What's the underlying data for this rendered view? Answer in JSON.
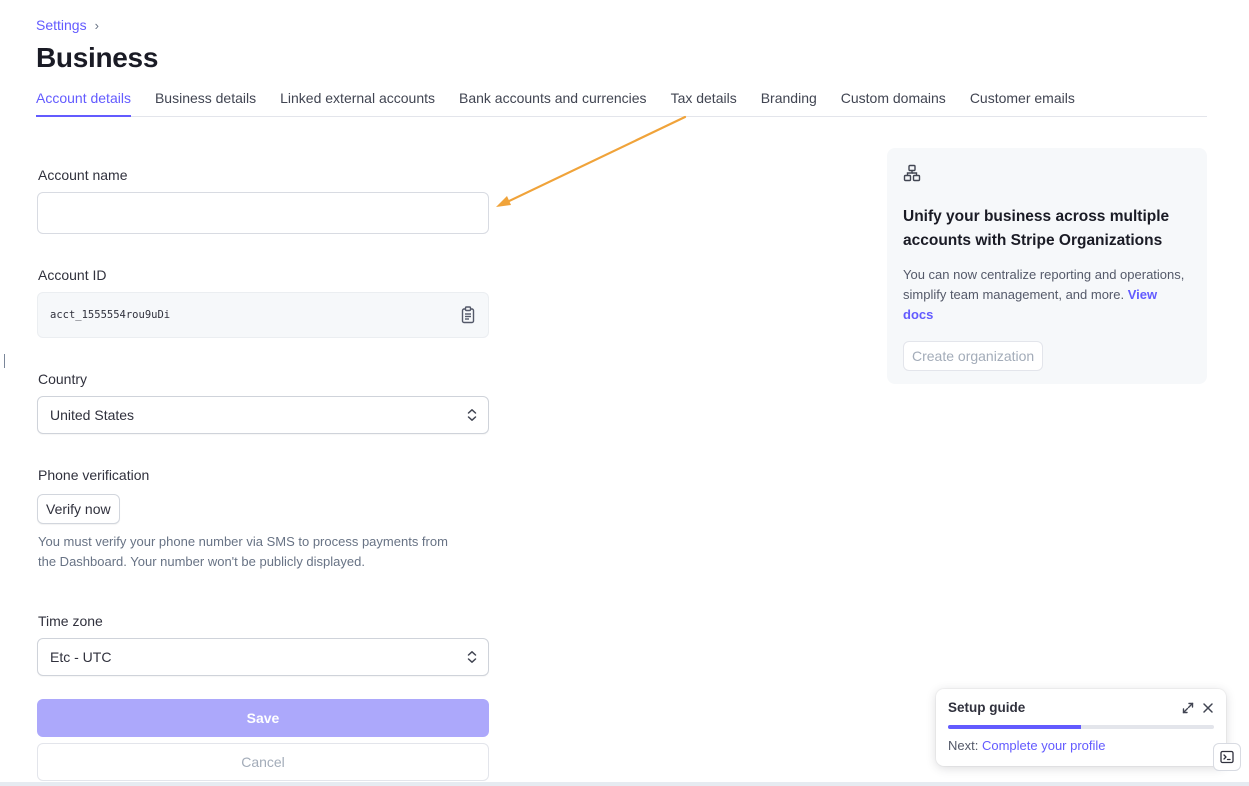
{
  "breadcrumb": {
    "parent": "Settings",
    "separator": "›"
  },
  "page": {
    "title": "Business"
  },
  "tabs": [
    {
      "label": "Account details",
      "active": true
    },
    {
      "label": "Business details",
      "active": false
    },
    {
      "label": "Linked external accounts",
      "active": false
    },
    {
      "label": "Bank accounts and currencies",
      "active": false
    },
    {
      "label": "Tax details",
      "active": false
    },
    {
      "label": "Branding",
      "active": false
    },
    {
      "label": "Custom domains",
      "active": false
    },
    {
      "label": "Customer emails",
      "active": false
    }
  ],
  "form": {
    "account_name": {
      "label": "Account name",
      "value": "",
      "placeholder": ""
    },
    "account_id": {
      "label": "Account ID",
      "value": "acct_1555554rou9uDi",
      "icon": "clipboard-icon"
    },
    "country": {
      "label": "Country",
      "value": "United States"
    },
    "phone": {
      "label": "Phone verification",
      "button": "Verify now",
      "help": "You must verify your phone number via SMS to process payments from the Dashboard. Your number won't be publicly displayed."
    },
    "timezone": {
      "label": "Time zone",
      "value": "Etc - UTC"
    },
    "save_label": "Save",
    "cancel_label": "Cancel"
  },
  "org_card": {
    "icon": "organization-icon",
    "title": "Unify your business across multiple accounts with Stripe Organizations",
    "text": "You can now centralize reporting and operations, simplify team management, and more.",
    "link": "View docs",
    "button": "Create organization"
  },
  "setup_guide": {
    "title": "Setup guide",
    "progress": 0.5,
    "next_prefix": "Next:",
    "next_link": "Complete your profile"
  },
  "colors": {
    "accent": "#635bff",
    "annotation_arrow": "#f0a33a",
    "save_disabled": "#aca8fb"
  }
}
